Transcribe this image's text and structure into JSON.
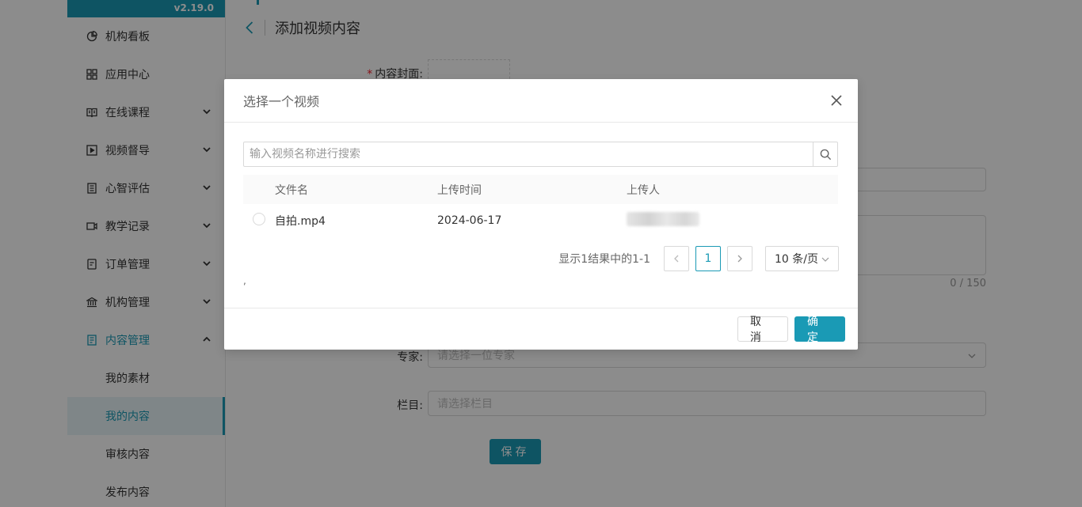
{
  "sidebar": {
    "version": "v2.19.0",
    "items": [
      {
        "label": "机构看板",
        "icon": "pie-chart-icon"
      },
      {
        "label": "应用中心",
        "icon": "grid-icon"
      },
      {
        "label": "在线课程",
        "icon": "book-icon"
      },
      {
        "label": "视频督导",
        "icon": "video-play-icon"
      },
      {
        "label": "心智评估",
        "icon": "report-icon"
      },
      {
        "label": "教学记录",
        "icon": "camera-icon"
      },
      {
        "label": "订单管理",
        "icon": "order-icon"
      },
      {
        "label": "机构管理",
        "icon": "bank-icon"
      },
      {
        "label": "内容管理",
        "icon": "content-icon"
      }
    ],
    "sub_items": [
      {
        "label": "我的素材"
      },
      {
        "label": "我的内容"
      },
      {
        "label": "审核内容"
      },
      {
        "label": "发布内容"
      }
    ]
  },
  "page": {
    "title": "添加视频内容",
    "cover_label": "内容封面:",
    "expert_label": "专家:",
    "expert_placeholder": "请选择一位专家",
    "column_label": "栏目:",
    "column_placeholder": "请选择栏目",
    "counter": "0 / 150",
    "save_label": "保存"
  },
  "modal": {
    "title": "选择一个视频",
    "search_placeholder": "输入视频名称进行搜索",
    "columns": {
      "name": "文件名",
      "time": "上传时间",
      "user": "上传人"
    },
    "rows": [
      {
        "name": "自拍.mp4",
        "time": "2024-06-17"
      }
    ],
    "pagination": {
      "total_text": "显示1结果中的1-1",
      "current_page": "1",
      "page_size": "10 条/页"
    },
    "mark": ",",
    "cancel_label": "取消",
    "ok_label": "确定"
  },
  "colors": {
    "accent": "#1a9ab5"
  }
}
